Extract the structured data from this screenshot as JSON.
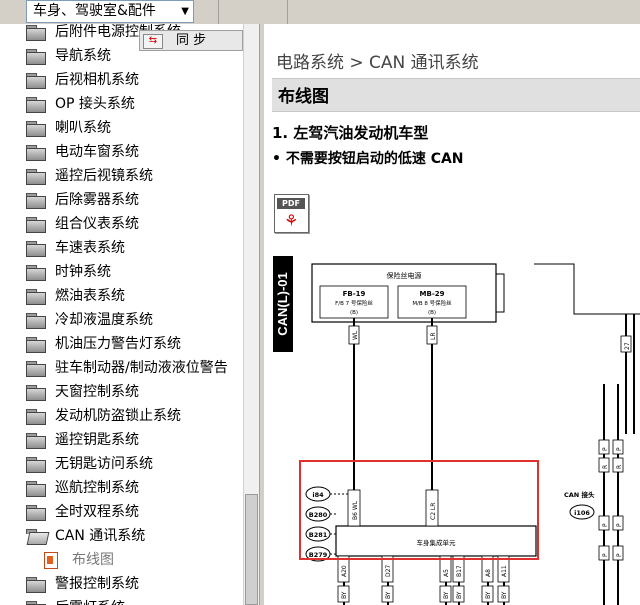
{
  "category_select": {
    "value": "车身、驾驶室&配件"
  },
  "sync_button": {
    "label": "同  步"
  },
  "tree": {
    "items": [
      {
        "label": "后附件电源控制系统"
      },
      {
        "label": "导航系统"
      },
      {
        "label": "后视相机系统"
      },
      {
        "label": "OP 接头系统"
      },
      {
        "label": "喇叭系统"
      },
      {
        "label": "电动车窗系统"
      },
      {
        "label": "遥控后视镜系统"
      },
      {
        "label": "后除雾器系统"
      },
      {
        "label": "组合仪表系统"
      },
      {
        "label": "车速表系统"
      },
      {
        "label": "时钟系统"
      },
      {
        "label": "燃油表系统"
      },
      {
        "label": "冷却液温度系统"
      },
      {
        "label": "机油压力警告灯系统"
      },
      {
        "label": "驻车制动器/制动液液位警告"
      },
      {
        "label": "天窗控制系统"
      },
      {
        "label": "发动机防盗锁止系统"
      },
      {
        "label": "遥控钥匙系统"
      },
      {
        "label": "无钥匙访问系统"
      },
      {
        "label": "巡航控制系统"
      },
      {
        "label": "全时双程系统"
      },
      {
        "label": "CAN 通讯系统"
      },
      {
        "label": "布线图"
      },
      {
        "label": "警报控制系统"
      },
      {
        "label": "后雾灯系统"
      }
    ]
  },
  "content": {
    "breadcrumb": "电路系统 > CAN 通讯系统",
    "section_title": "布线图",
    "heading1": "1. 左驾汽油发动机车型",
    "bullet1": "• 不需要按钮启动的低速 CAN",
    "pdf_icon_label": "PDF"
  },
  "diagram": {
    "side_label": "CAN(L)-01",
    "top_box": {
      "title": "保险丝电源",
      "fb19": "FB-19",
      "fb19_sub": "F/B 7 号保险丝",
      "fb19_pin": "(B)",
      "mb29": "MB-29",
      "mb29_sub": "M/B 8 号保险丝",
      "mb29_pin": "(B)"
    },
    "wire_labels_top": [
      "WL",
      "LR"
    ],
    "connectors_left": [
      "i84",
      "B280",
      "B281",
      "B279"
    ],
    "pins_mid": [
      "B6 WL",
      "C2 LR"
    ],
    "unit_label": "车身集成单元",
    "pins_bottom": [
      "A20",
      "D27",
      "A5",
      "B17",
      "A8",
      "A11"
    ],
    "wire_labels_bottom": [
      "BY",
      "BY",
      "BY",
      "BY",
      "BY",
      "BY"
    ],
    "can_label": "CAN 接头",
    "can_connector": "i106",
    "right_pins": [
      "P",
      "P",
      "R",
      "R",
      "P",
      "P",
      "P",
      "P",
      "27"
    ],
    "highlight_color": "#e03030"
  }
}
